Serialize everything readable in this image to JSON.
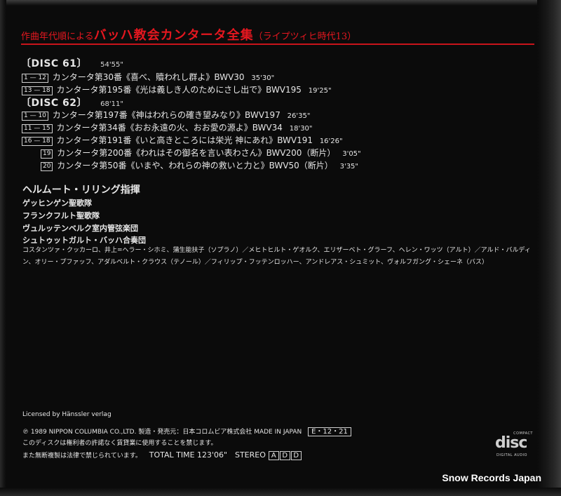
{
  "title": {
    "prefix": "作曲年代順による",
    "main": "バッハ教会カンタータ全集",
    "suffix": "（ライプツィヒ時代13）"
  },
  "discs": [
    {
      "label": "〔DISC 61〕",
      "duration": "54'55\"",
      "tracks": [
        {
          "num": "1 — 12",
          "text": "カンタータ第30番《喜べ、贖われし群よ》BWV30",
          "time": "35'30\""
        },
        {
          "num": "13 — 18",
          "text": "カンタータ第195番《光は義しき人のためにさし出で》BWV195",
          "time": "19'25\""
        }
      ]
    },
    {
      "label": "〔DISC 62〕",
      "duration": "68'11\"",
      "tracks": [
        {
          "num": "1 — 10",
          "text": "カンタータ第197番《神はわれらの確き望みなり》BWV197",
          "time": "26'35\""
        },
        {
          "num": "11 — 15",
          "text": "カンタータ第34番《おお永遠の火、おお愛の源よ》BWV34",
          "time": "18'30\""
        },
        {
          "num": "16 — 18",
          "text": "カンタータ第191番《いと高きところには栄光 神にあれ》BWV191",
          "time": "16'26\""
        },
        {
          "num": "19",
          "text": "カンタータ第200番《われはその御名を言い表わさん》BWV200（断片）",
          "time": "3'05\""
        },
        {
          "num": "20",
          "text": "カンタータ第50番《いまや、われらの神の救いと力と》BWV50（断片）",
          "time": "3'35\""
        }
      ]
    }
  ],
  "conductor": "ヘルムート・リリング指揮",
  "ensembles": [
    "ゲッヒンゲン聖歌隊",
    "フランクフルト聖歌隊",
    "ヴュルッテンベルク室内管弦楽団",
    "シュトゥットガルト・バッハ合奏団"
  ],
  "soloists": "コスタンツァ・クッカーロ、井上=ヘラー・シホミ、蒲生能扶子（ソプラノ）／メヒトヒルト・ゲオルク、エリザーベト・グラーフ、ヘレン・ワッツ（アルト）／アルド・バルディン、オリー・プファッフ、アダルベルト・クラウス（テノール）／フィリップ・フッテンロッハー、アンドレアス・シュミット、ヴォルフガング・シェーネ（バス）",
  "license": "Licensed by Hänssler verlag",
  "copyright": "℗ 1989 NIPPON COLUMBIA CO.,LTD. 製造・発売元：日本コロムビア株式会社 MADE IN JAPAN",
  "catalog": "E・12・21",
  "notice1": "このディスクは権利者の許諾なく賃貸業に使用することを禁じます。",
  "notice2": "また無断複製は法律で禁じられています。",
  "total_time": "TOTAL TIME 123'06\"",
  "stereo": "STEREO",
  "add_letters": [
    "A",
    "D",
    "D"
  ],
  "logo": {
    "top": "COMPACT",
    "main": "disc",
    "bottom": "DIGITAL AUDIO"
  },
  "watermark": "Snow Records Japan",
  "colors": {
    "accent": "#e4171f",
    "background": "#0b0b0b",
    "text": "#e6e6e6"
  }
}
